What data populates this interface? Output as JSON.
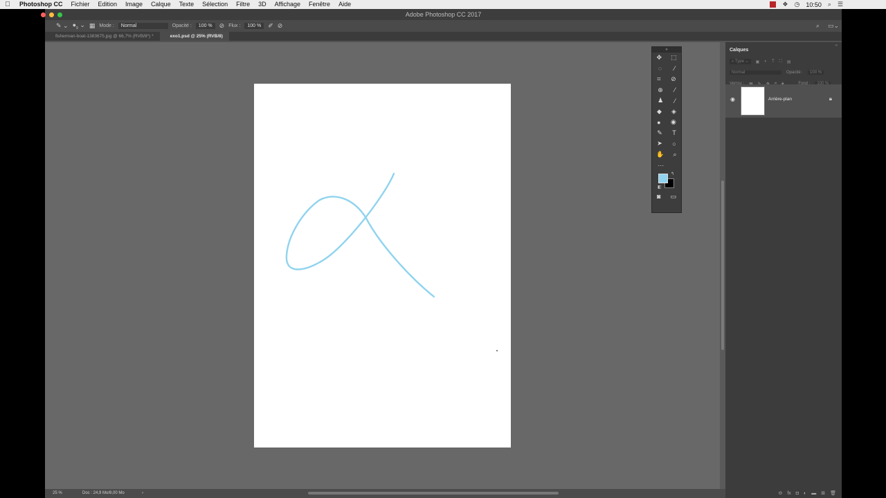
{
  "menubar": {
    "apple_icon": "apple-icon",
    "app_name": "Photoshop CC",
    "items": [
      "Fichier",
      "Edition",
      "Image",
      "Calque",
      "Texte",
      "Sélection",
      "Filtre",
      "3D",
      "Affichage",
      "Fenêtre",
      "Aide"
    ],
    "clock": "10:50"
  },
  "window": {
    "title": "Adobe Photoshop CC 2017"
  },
  "options": {
    "mode_label": "Mode :",
    "mode_value": "Normal",
    "opacity_label": "Opacité :",
    "opacity_value": "100 %",
    "flux_label": "Flux :",
    "flux_value": "100 %",
    "brush_size": "9"
  },
  "tabs": [
    {
      "label": "fisherman-boat-1383675.jpg @ 66,7% (RVB/8*) *",
      "active": false
    },
    {
      "label": "exo1.psd @ 25% (RVB/8)",
      "active": true
    }
  ],
  "status": {
    "zoom": "25 %",
    "doc": "Doc : 24,9 Mo/8,00 Mo",
    "arrow": "›"
  },
  "tools": {
    "rows": [
      [
        "move-icon",
        "marquee-icon"
      ],
      [
        "lasso-icon",
        "magic-wand-icon"
      ],
      [
        "crop-icon",
        "eyedropper-icon"
      ],
      [
        "healing-icon",
        "brush-icon"
      ],
      [
        "stamp-icon",
        "history-brush-icon"
      ],
      [
        "eraser-icon",
        "paint-bucket-icon"
      ],
      [
        "blur-icon",
        "dodge-icon"
      ],
      [
        "pen-icon",
        "type-icon"
      ],
      [
        "path-select-icon",
        "ellipse-icon"
      ],
      [
        "hand-icon",
        "zoom-icon"
      ]
    ],
    "glyphs": {
      "move-icon": "✥",
      "marquee-icon": "⬚",
      "lasso-icon": "◌",
      "magic-wand-icon": "⁄",
      "crop-icon": "⌗",
      "eyedropper-icon": "⊘",
      "healing-icon": "⊕",
      "brush-icon": "⁄",
      "stamp-icon": "♟",
      "history-brush-icon": "⁄",
      "eraser-icon": "◆",
      "paint-bucket-icon": "◈",
      "blur-icon": "●",
      "dodge-icon": "◉",
      "pen-icon": "✎",
      "type-icon": "T",
      "path-select-icon": "➤",
      "ellipse-icon": "○",
      "hand-icon": "✋",
      "zoom-icon": "⌕"
    },
    "foreground_color": "#8fd3ee",
    "background_color": "#000000"
  },
  "layers": {
    "panel_title": "Calques",
    "filter_placeholder": "Type",
    "blend_mode": "Normal",
    "opacity_label": "Opacité :",
    "opacity_value": "100 %",
    "lock_label": "Verrou :",
    "fill_label": "Fond :",
    "fill_value": "100 %",
    "layer_name": "Arrière-plan"
  },
  "colors": {
    "stroke": "#8fd3ee",
    "canvas_bg": "#686868",
    "ui_dark": "#3c3c3c"
  }
}
